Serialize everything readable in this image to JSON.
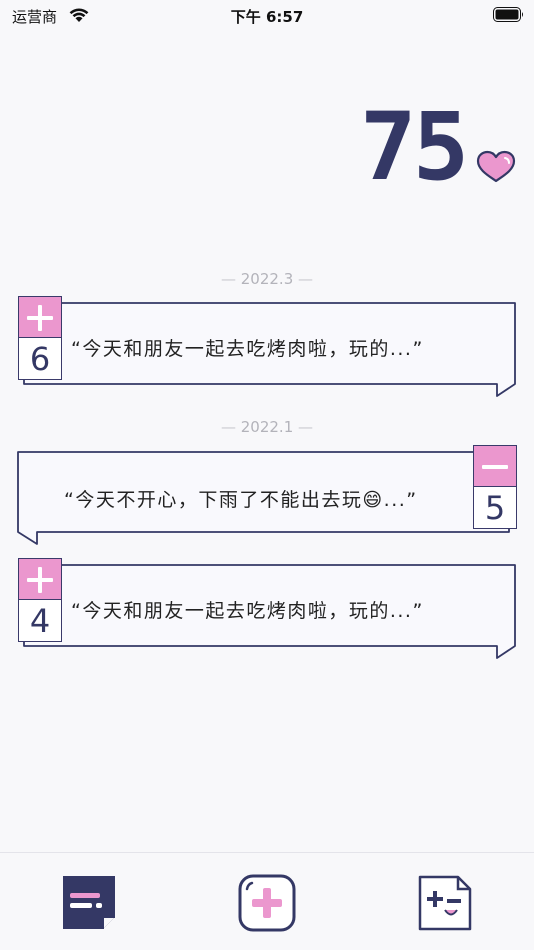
{
  "status_bar": {
    "carrier": "运营商",
    "time": "下午 6:57"
  },
  "score": {
    "value": "75",
    "icon": "heart-icon",
    "heart_color": "#eb97ce"
  },
  "colors": {
    "primary": "#343865",
    "accent": "#eb97ce",
    "card_bg": "#f9f9fd"
  },
  "groups": [
    {
      "date": "2022.3",
      "entries": [
        {
          "sign": "plus",
          "points": "6",
          "text": "“今天和朋友一起去吃烤肉啦，玩的...”"
        }
      ]
    },
    {
      "date": "2022.1",
      "entries": [
        {
          "sign": "minus",
          "points": "5",
          "text": "“今天不开心，下雨了不能出去玩😄...”"
        },
        {
          "sign": "plus",
          "points": "4",
          "text": "“今天和朋友一起去吃烤肉啦，玩的...”"
        }
      ]
    }
  ],
  "tab_bar": {
    "tabs": [
      {
        "name": "list",
        "icon": "note-list-icon"
      },
      {
        "name": "add",
        "icon": "add-plus-icon"
      },
      {
        "name": "calc",
        "icon": "plus-minus-icon"
      }
    ]
  }
}
